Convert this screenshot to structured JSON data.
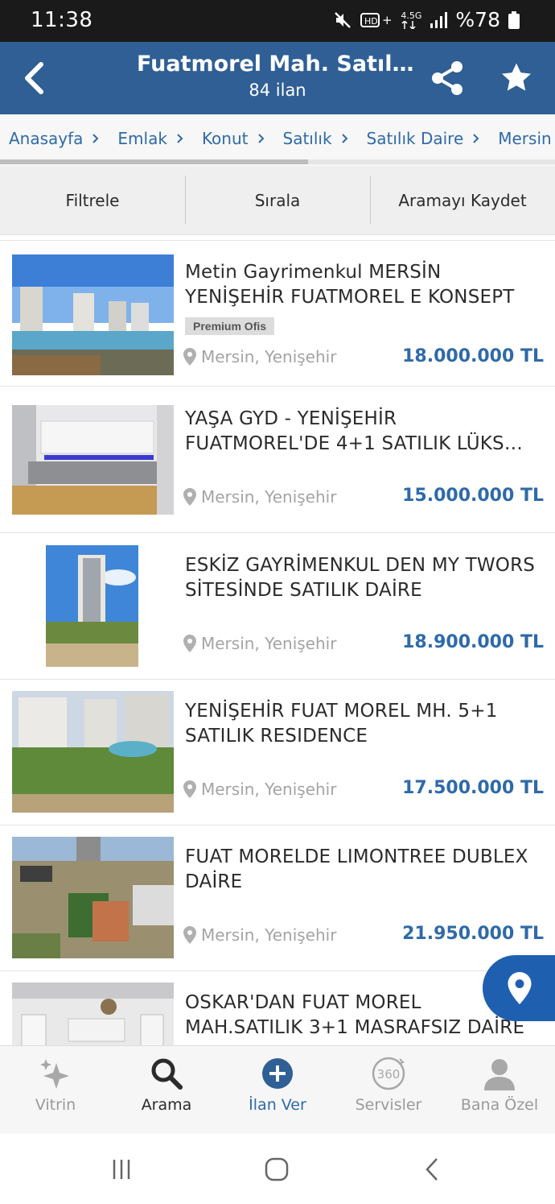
{
  "status": {
    "time": "11:38",
    "network": "4.5G",
    "battery": "%78"
  },
  "header": {
    "title": "Fuatmorel Mah. Satılık…",
    "subtitle": "84 ilan"
  },
  "breadcrumb": {
    "items": [
      "Anasayfa",
      "Emlak",
      "Konut",
      "Satılık",
      "Satılık Daire",
      "Mersin"
    ]
  },
  "actions": {
    "filter": "Filtrele",
    "sort": "Sırala",
    "save_search": "Aramayı Kaydet"
  },
  "listings": [
    {
      "title": "Metin Gayrimenkul MERSİN YENİŞEHİR FUATMOREL E KONSEPT",
      "badge": "Premium Ofis",
      "location": "Mersin, Yenişehir",
      "price": "18.000.000 TL"
    },
    {
      "title": "YAŞA GYD - YENİŞEHİR FUATMOREL'DE 4+1 SATILIK LÜKS…",
      "location": "Mersin, Yenişehir",
      "price": "15.000.000 TL"
    },
    {
      "title": "ESKİZ GAYRİMENKUL DEN MY TWORS SİTESİNDE SATILIK DAİRE",
      "location": "Mersin, Yenişehir",
      "price": "18.900.000 TL"
    },
    {
      "title": "YENİŞEHİR FUAT MOREL MH. 5+1 SATILIK RESIDENCE",
      "location": "Mersin, Yenişehir",
      "price": "17.500.000 TL"
    },
    {
      "title": "FUAT MORELDE LIMONTREE DUBLEX DAİRE",
      "location": "Mersin, Yenişehir",
      "price": "21.950.000 TL"
    },
    {
      "title": "OSKAR'DAN FUAT MOREL MAH.SATILIK 3+1 MASRAFSIZ DAİRE",
      "location": "",
      "price": ""
    }
  ],
  "bottom_nav": {
    "showcase": "Vitrin",
    "search": "Arama",
    "post_ad": "İlan Ver",
    "services": "Servisler",
    "services_icon_text": "360",
    "profile": "Bana Özel"
  },
  "colors": {
    "header_bg": "#2f5f94",
    "link_blue": "#2f6aa8",
    "map_fab": "#1f5fb0"
  }
}
